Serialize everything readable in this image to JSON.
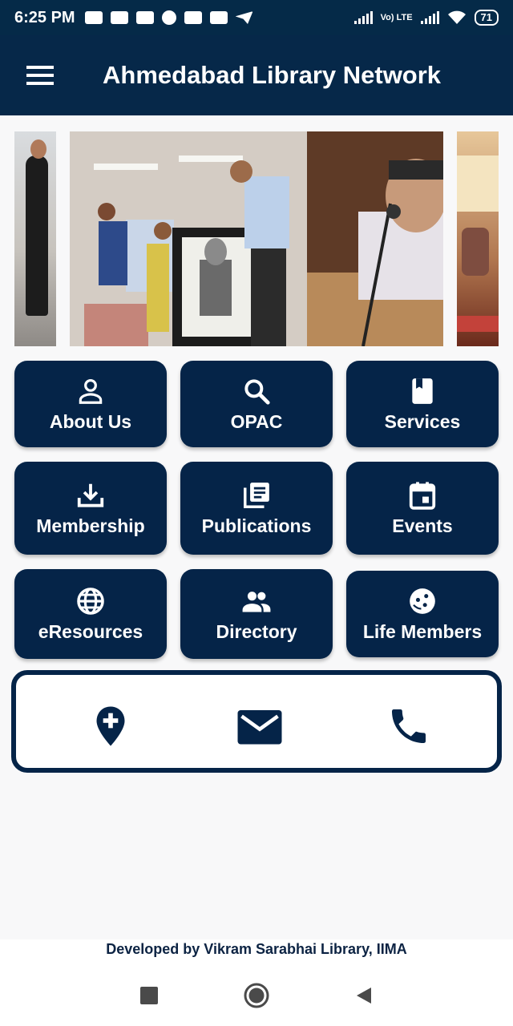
{
  "status_bar": {
    "time": "6:25 PM",
    "battery": "71",
    "volte": "Vo) LTE"
  },
  "app_bar": {
    "title": "Ahmedabad Library Network"
  },
  "tiles": [
    {
      "label": "About Us",
      "icon": "person-icon"
    },
    {
      "label": "OPAC",
      "icon": "search-icon"
    },
    {
      "label": "Services",
      "icon": "book-icon"
    },
    {
      "label": "Membership",
      "icon": "download-icon"
    },
    {
      "label": "Publications",
      "icon": "library-books-icon"
    },
    {
      "label": "Events",
      "icon": "calendar-icon"
    },
    {
      "label": "eResources",
      "icon": "globe-icon"
    },
    {
      "label": "Directory",
      "icon": "people-icon"
    },
    {
      "label": "Life Members",
      "icon": "face-icon"
    }
  ],
  "contact": [
    {
      "icon": "add-location-icon"
    },
    {
      "icon": "email-icon"
    },
    {
      "icon": "phone-icon"
    }
  ],
  "footer": {
    "text": "Developed by Vikram Sarabhai Library, IIMA"
  },
  "colors": {
    "primary": "#052448",
    "app_bar": "#062849",
    "background": "#f8f8f9"
  }
}
